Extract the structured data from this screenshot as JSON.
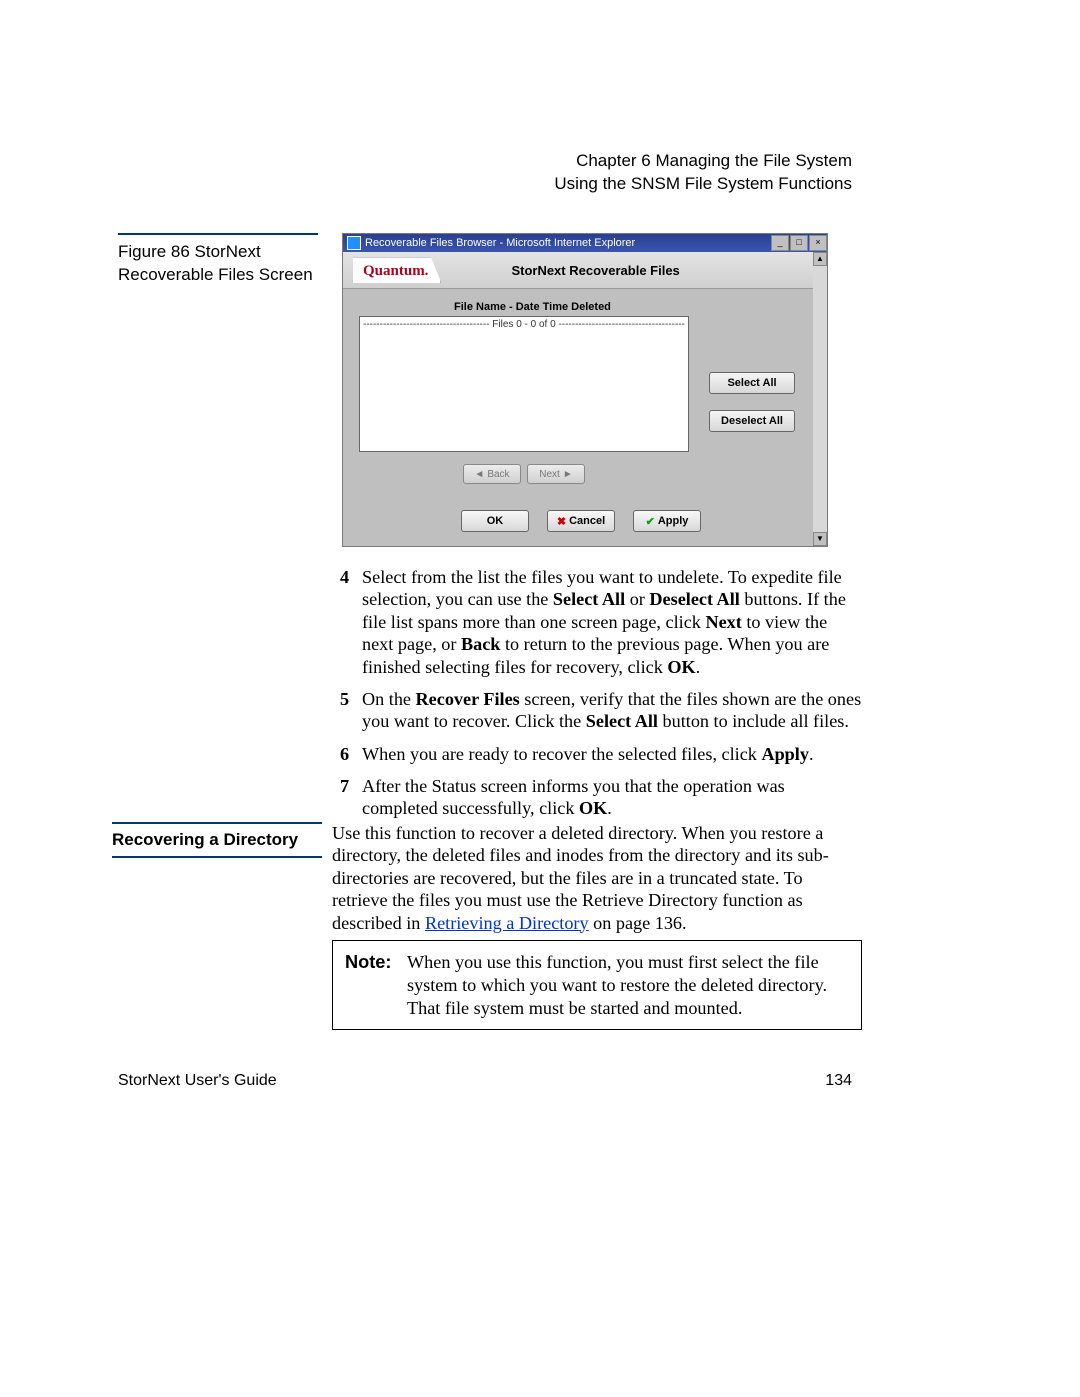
{
  "header": {
    "chapter": "Chapter 6  Managing the File System",
    "subtitle": "Using the SNSM File System Functions"
  },
  "figure": {
    "caption_line1": "Figure 86  StorNext",
    "caption_line2": "Recoverable Files Screen"
  },
  "screenshot": {
    "window_title": "Recoverable Files Browser - Microsoft Internet Explorer",
    "brand": "Quantum.",
    "app_title": "StorNext Recoverable Files",
    "list_header": "File Name - Date Time Deleted",
    "list_status": "-------------------------------------- Files 0 - 0 of 0 --------------------------------------",
    "select_all": "Select All",
    "deselect_all": "Deselect All",
    "back": "Back",
    "next": "Next",
    "ok": "OK",
    "cancel": "Cancel",
    "apply": "Apply"
  },
  "steps": {
    "s4": {
      "n": "4",
      "t1": "Select from the list the files you want to undelete. To expedite file selection, you can use the ",
      "b1": "Select All",
      "t2": " or ",
      "b2": "Deselect All",
      "t3": " buttons. If the file list spans more than one screen page, click ",
      "b3": "Next",
      "t4": " to view the next page, or ",
      "b4": "Back",
      "t5": " to return to the previous page. When you are finished selecting files for recovery, click ",
      "b5": "OK",
      "t6": "."
    },
    "s5": {
      "n": "5",
      "t1": "On the ",
      "b1": "Recover Files",
      "t2": " screen, verify that the files shown are the ones you want to recover. Click the ",
      "b2": "Select All",
      "t3": " button to include all files."
    },
    "s6": {
      "n": "6",
      "t1": "When you are ready to recover the selected files, click ",
      "b1": "Apply",
      "t2": "."
    },
    "s7": {
      "n": "7",
      "t1": "After the Status screen informs you that the operation was completed successfully, click ",
      "b1": "OK",
      "t2": "."
    }
  },
  "section": {
    "title": "Recovering a Directory",
    "body_t1": "Use this function to recover a deleted directory. When you restore a directory, the deleted files and inodes from the directory and its sub-directories are recovered, but the files are in a truncated state. To retrieve the files you must use the Retrieve Directory function as described in ",
    "body_link": "Retrieving a Directory",
    "body_t2": " on page  136."
  },
  "note": {
    "label": "Note:",
    "text": "When you use this function, you must first select the file system to which you want to restore the deleted directory. That file system must be started and mounted."
  },
  "footer": {
    "left": "StorNext User's Guide",
    "right": "134"
  }
}
